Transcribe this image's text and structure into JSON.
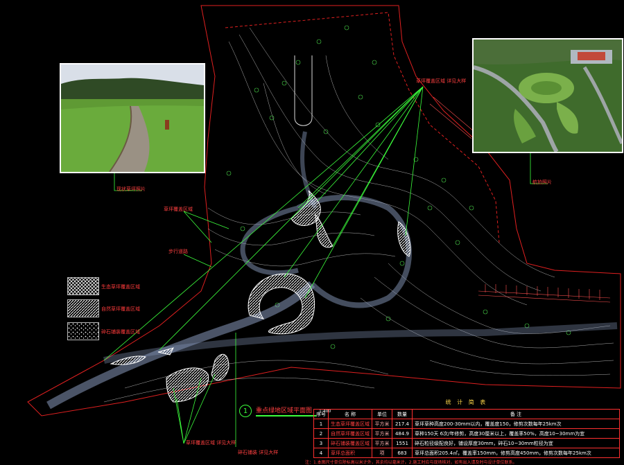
{
  "drawing": {
    "plan_title_number": "1",
    "plan_title": "重点绿地区域平面图",
    "plan_scale": "1:400"
  },
  "legend": {
    "items": [
      {
        "pattern": "crosshatch",
        "label": "生态草坪覆盖区域"
      },
      {
        "pattern": "diagonal",
        "label": "自然草坪覆盖区域"
      },
      {
        "pattern": "stipple",
        "label": "碎石铺装覆盖区域"
      }
    ]
  },
  "annotations": {
    "top_right_callout": "草坪覆盖区域 详见大样",
    "left_photo_callout": "现状草坪照片",
    "right_photo_callout": "航拍照片",
    "mid_left_callout": "草坪覆盖区域",
    "left_road": "步行道路",
    "bottom_left_callout": "草坪覆盖区域 详见大样",
    "bottom_center_callout": "碎石铺装 详见大样"
  },
  "stats_table": {
    "title": "统 计 简 表",
    "headers": [
      "序号",
      "名 称",
      "单位",
      "数量",
      "备 注"
    ],
    "rows": [
      {
        "no": "1",
        "name": "生态草坪覆盖区域",
        "unit": "平方米",
        "qty": "217.4",
        "note": "草坪草种高度200-30mm以内，覆盖度150，修剪次数每年25km次"
      },
      {
        "no": "2",
        "name": "自然草坪覆盖区域",
        "unit": "平方米",
        "qty": "484.9",
        "note": "草种150天 6次/年修剪，高度30厘米以上，覆盖率50%，高度10~30mm为宜"
      },
      {
        "no": "3",
        "name": "碎石铺装覆盖区域",
        "unit": "平方米",
        "qty": "1551",
        "note": "碎石粒径级配良好，铺设厚度30mm，碎石10~30mm粒径为宜"
      },
      {
        "no": "4",
        "name": "草坪总面积",
        "unit": "项",
        "qty": "683",
        "note": "草坪总面积205.4㎡，覆盖率150mm，修剪高度450mm，修剪次数每年25km次"
      }
    ]
  },
  "footer_note": "注：1.本图尺寸单位除标高以米计外，其余均以毫米计。2.施工时应与现场核对，如有出入请及时与设计单位联系。"
}
